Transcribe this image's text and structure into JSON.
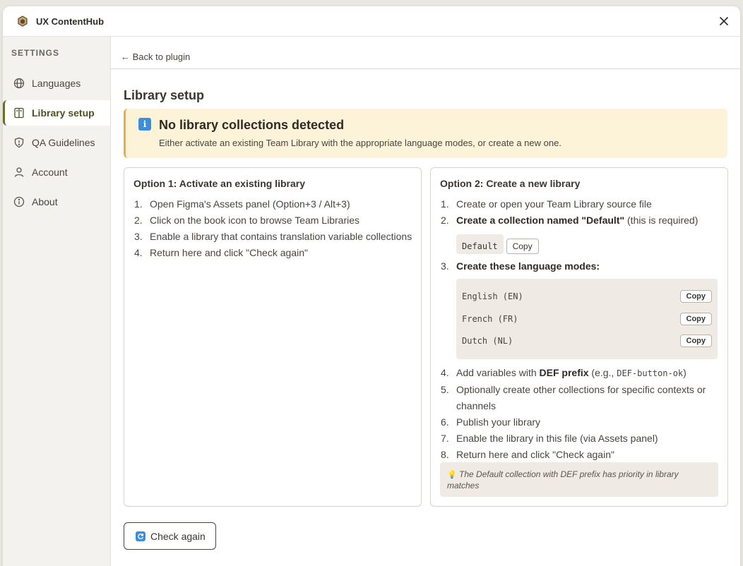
{
  "app": {
    "title": "UX ContentHub",
    "accent_color": "#6b6d2a"
  },
  "sidebar": {
    "heading": "SETTINGS",
    "items": [
      {
        "label": "Languages",
        "icon": "globe-icon"
      },
      {
        "label": "Library setup",
        "icon": "book-icon",
        "active": true
      },
      {
        "label": "QA Guidelines",
        "icon": "shield-icon"
      },
      {
        "label": "Account",
        "icon": "user-icon"
      },
      {
        "label": "About",
        "icon": "info-icon"
      }
    ]
  },
  "main": {
    "back_link": "← Back to plugin",
    "page_title": "Library setup",
    "alert": {
      "icon": "i",
      "title": "No library collections detected",
      "text": "Either activate an existing Team Library with the appropriate language modes, or create a new one."
    },
    "option1": {
      "title": "Option 1: Activate an existing library",
      "steps": [
        "Open Figma's Assets panel (Option+3 / Alt+3)",
        "Click on the book icon to browse Team Libraries",
        "Enable a library that contains translation variable collections",
        "Return here and click \"Check again\""
      ]
    },
    "option2": {
      "title": "Option 2: Create a new library",
      "step1": "Create or open your Team Library source file",
      "step2_bold": "Create a collection named \"Default\"",
      "step2_rest": " (this is required)",
      "default_code": "Default",
      "copy_label": "Copy",
      "step3_bold": "Create these language modes:",
      "modes": [
        {
          "code": "English (EN)",
          "copy": "Copy"
        },
        {
          "code": "French (FR)",
          "copy": "Copy"
        },
        {
          "code": "Dutch (NL)",
          "copy": "Copy"
        }
      ],
      "step4_pre": "Add variables with ",
      "step4_bold": "DEF prefix",
      "step4_mid": " (e.g., ",
      "step4_code": "DEF-button-ok",
      "step4_post": ")",
      "step5": "Optionally create other collections for specific contexts or channels",
      "step6": "Publish your library",
      "step7": "Enable the library in this file (via Assets panel)",
      "step8": "Return here and click \"Check again\"",
      "tip_icon": "💡",
      "tip": "The Default collection with DEF prefix has priority in library matches"
    },
    "check_again": "Check again"
  },
  "numbers": [
    "1.",
    "2.",
    "3.",
    "4.",
    "5.",
    "6.",
    "7.",
    "8."
  ]
}
